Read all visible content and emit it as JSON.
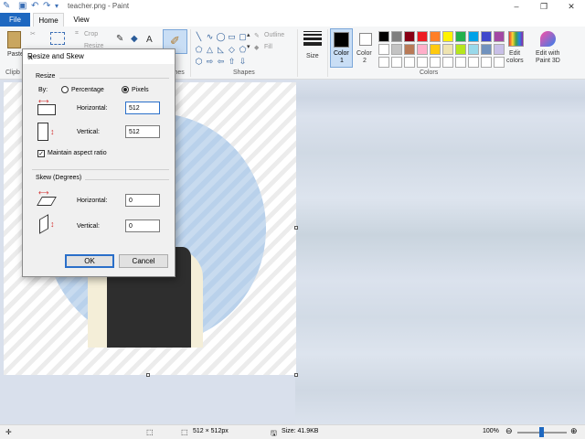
{
  "window": {
    "title": "teacher.png - Paint",
    "minimize_glyph": "–",
    "restore_glyph": "❐",
    "close_glyph": "✕"
  },
  "quick_access": [
    "save-icon",
    "undo-icon",
    "redo-icon",
    "customize-icon"
  ],
  "tabs": {
    "file": "File",
    "home": "Home",
    "view": "View"
  },
  "ribbon": {
    "clipboard": {
      "paste": "Paste",
      "label": "Clipb"
    },
    "image": {
      "crop": "Crop",
      "resize": "Resize"
    },
    "brushes": {
      "label": "ches"
    },
    "shapes": {
      "outline": "Outline",
      "fill": "Fill",
      "label": "Shapes"
    },
    "size": {
      "label": "Size"
    },
    "color1": {
      "label": "Color",
      "number": "1",
      "value": "#000000"
    },
    "color2": {
      "label": "Color",
      "number": "2",
      "value": "#ffffff"
    },
    "colors_label": "Colors",
    "edit_colors": [
      "Edit",
      "colors"
    ],
    "paint3d": [
      "Edit with",
      "Paint 3D"
    ],
    "palette": [
      "#000000",
      "#7f7f7f",
      "#880015",
      "#ed1c24",
      "#ff7f27",
      "#fff200",
      "#22b14c",
      "#00a2e8",
      "#3f48cc",
      "#a349a4",
      "#ffffff",
      "#c3c3c3",
      "#b97a57",
      "#ffaec9",
      "#ffc90e",
      "#efe4b0",
      "#b5e61d",
      "#99d9ea",
      "#7092be",
      "#c8bfe7",
      "#ffffff",
      "#ffffff",
      "#ffffff",
      "#ffffff",
      "#ffffff",
      "#ffffff",
      "#ffffff",
      "#ffffff",
      "#ffffff",
      "#ffffff"
    ]
  },
  "dialog": {
    "title": "Resize and Skew",
    "resize_label": "Resize",
    "by_label": "By:",
    "percentage_label": "Percentage",
    "pixels_label": "Pixels",
    "selected_unit": "Pixels",
    "horizontal_label": "Horizontal:",
    "horizontal_value": "512",
    "vertical_label": "Vertical:",
    "vertical_value": "512",
    "maintain_aspect_label": "Maintain aspect ratio",
    "maintain_aspect_checked": true,
    "skew_label": "Skew (Degrees)",
    "skew_horizontal_label": "Horizontal:",
    "skew_horizontal_value": "0",
    "skew_vertical_label": "Vertical:",
    "skew_vertical_value": "0",
    "ok_label": "OK",
    "cancel_label": "Cancel"
  },
  "statusbar": {
    "dimensions": "512 × 512px",
    "size": "Size: 41.9KB",
    "zoom": "100%",
    "zoom_level": 1.0
  }
}
